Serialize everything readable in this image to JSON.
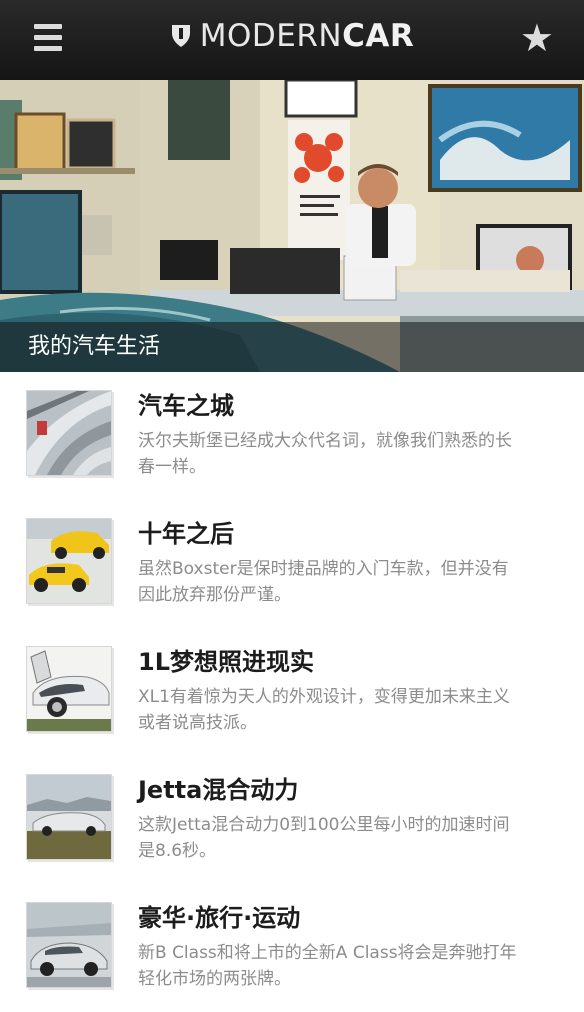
{
  "header": {
    "brand_part1": "MODERN",
    "brand_part2": "CAR",
    "menu_icon": "hamburger-menu-icon",
    "favorite_icon": "star-icon"
  },
  "hero": {
    "caption": "我的汽车生活"
  },
  "articles": [
    {
      "title": "汽车之城",
      "desc": "沃尔夫斯堡已经成大众代名词，就像我们熟悉的长春一样。"
    },
    {
      "title": "十年之后",
      "desc": "虽然Boxster是保时捷品牌的入门车款，但并没有因此放弃那份严谨。"
    },
    {
      "title": "1L梦想照进现实",
      "desc": "XL1有着惊为天人的外观设计，变得更加未来主义或者说高技派。"
    },
    {
      "title": "Jetta混合动力",
      "desc": "这款Jetta混合动力0到100公里每小时的加速时间是8.6秒。"
    },
    {
      "title": "豪华·旅行·运动",
      "desc": "新B Class和将上市的全新A Class将会是奔驰打年轻化市场的两张牌。"
    }
  ]
}
